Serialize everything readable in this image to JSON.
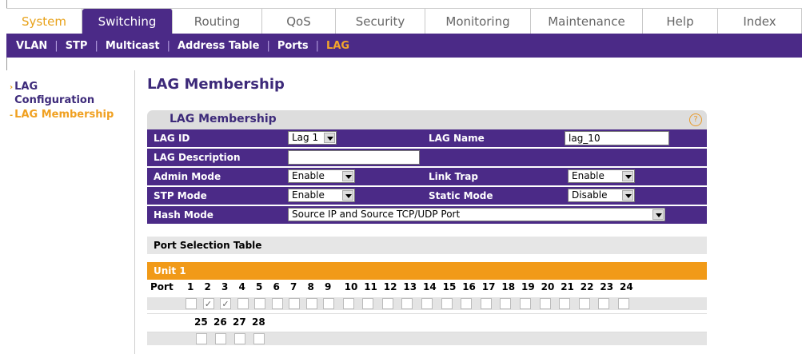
{
  "tabs": [
    "System",
    "Switching",
    "Routing",
    "QoS",
    "Security",
    "Monitoring",
    "Maintenance",
    "Help",
    "Index"
  ],
  "subnav": [
    "VLAN",
    "STP",
    "Multicast",
    "Address Table",
    "Ports",
    "LAG"
  ],
  "sidebar": {
    "item1": "LAG Configuration",
    "item2": "LAG Membership"
  },
  "page_title": "LAG Membership",
  "panel_title": "LAG Membership",
  "form": {
    "lag_id_label": "LAG ID",
    "lag_id_value": "Lag 1",
    "lag_name_label": "LAG Name",
    "lag_name_value": "lag_10",
    "lag_desc_label": "LAG Description",
    "lag_desc_value": "",
    "admin_mode_label": "Admin Mode",
    "admin_mode_value": "Enable",
    "link_trap_label": "Link Trap",
    "link_trap_value": "Enable",
    "stp_mode_label": "STP Mode",
    "stp_mode_value": "Enable",
    "static_mode_label": "Static Mode",
    "static_mode_value": "Disable",
    "hash_mode_label": "Hash Mode",
    "hash_mode_value": "Source IP and Source TCP/UDP Port"
  },
  "port_table": {
    "title": "Port Selection Table",
    "unit": "Unit 1",
    "port_label": "Port",
    "row1": [
      "1",
      "2",
      "3",
      "4",
      "5",
      "6",
      "7",
      "8",
      "9",
      "10",
      "11",
      "12",
      "13",
      "14",
      "15",
      "16",
      "17",
      "18",
      "19",
      "20",
      "21",
      "22",
      "23",
      "24"
    ],
    "row2": [
      "25",
      "26",
      "27",
      "28"
    ],
    "checked": [
      "2",
      "3"
    ]
  },
  "colors": {
    "accent_purple": "#4b2a87",
    "accent_orange": "#f19a18"
  }
}
